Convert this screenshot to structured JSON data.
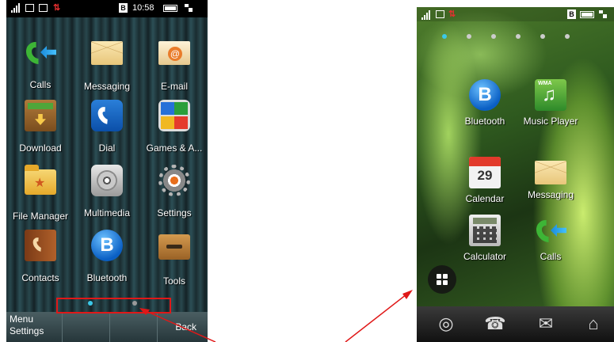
{
  "left_screen": {
    "status_bar": {
      "time": "10:58",
      "badge": "B"
    },
    "apps": [
      {
        "label": "Calls",
        "icon": "calls-icon"
      },
      {
        "label": "Messaging",
        "icon": "messaging-icon"
      },
      {
        "label": "E-mail",
        "icon": "email-icon"
      },
      {
        "label": "Download",
        "icon": "download-icon"
      },
      {
        "label": "Dial",
        "icon": "dial-icon"
      },
      {
        "label": "Games & A...",
        "icon": "games-icon"
      },
      {
        "label": "File Manager",
        "icon": "file-manager-icon"
      },
      {
        "label": "Multimedia",
        "icon": "multimedia-icon"
      },
      {
        "label": "Settings",
        "icon": "settings-icon"
      },
      {
        "label": "Contacts",
        "icon": "contacts-icon"
      },
      {
        "label": "Bluetooth",
        "icon": "bluetooth-icon",
        "glyph": "B"
      },
      {
        "label": "Tools",
        "icon": "tools-icon"
      }
    ],
    "page_indicator": {
      "pages": 2,
      "active": 1
    },
    "softkeys": {
      "left_top": "Menu",
      "left_bottom": "Settings",
      "right": "Back"
    }
  },
  "right_screen": {
    "status_bar": {
      "badge": "B"
    },
    "page_indicator": {
      "pages": 6,
      "active": 1
    },
    "apps": [
      {
        "label": "Bluetooth",
        "icon": "bluetooth-icon",
        "glyph": "B"
      },
      {
        "label": "Music Player",
        "icon": "music-player-icon",
        "badge": "WMA"
      },
      {
        "label": "Calendar",
        "icon": "calendar-icon",
        "glyph": "29"
      },
      {
        "label": "Messaging",
        "icon": "messaging-icon"
      },
      {
        "label": "Calculator",
        "icon": "calculator-icon"
      },
      {
        "label": "Calls",
        "icon": "calls-icon"
      }
    ],
    "dock": [
      "palette-icon",
      "phonebook-icon",
      "envelope-icon",
      "home-icon"
    ]
  },
  "colors": {
    "highlight": "#e01818",
    "active_dot": "#3bc8e8",
    "arrow": "#e01818"
  }
}
